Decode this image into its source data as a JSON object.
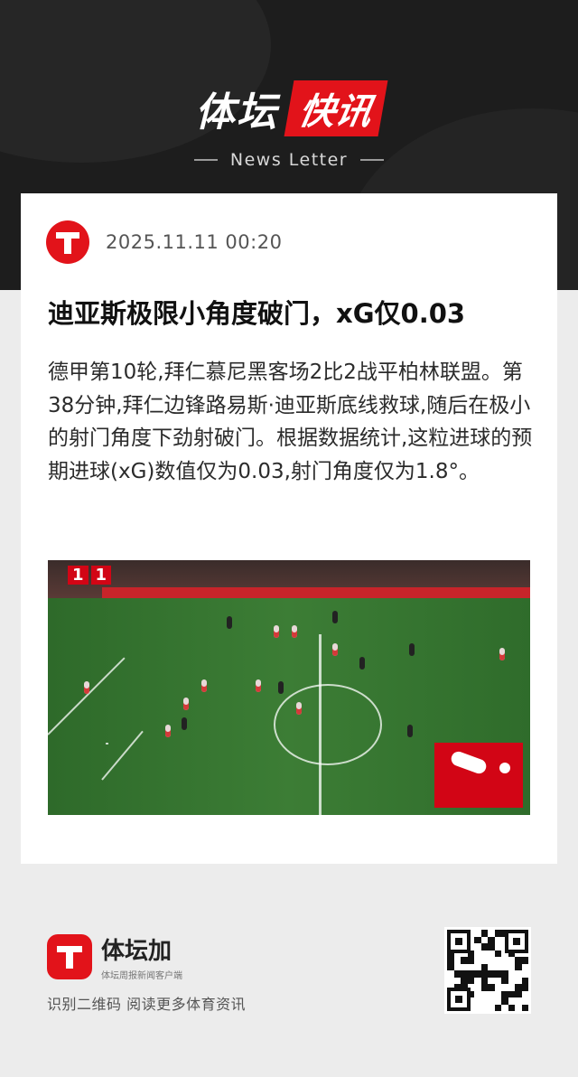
{
  "header": {
    "brand_main": "体坛",
    "brand_accent": "快讯",
    "brand_sub": "News Letter"
  },
  "article": {
    "timestamp": "2025.11.11 00:20",
    "title": "迪亚斯极限小角度破门，xG仅0.03",
    "body": "德甲第10轮,拜仁慕尼黑客场2比2战平柏林联盟。第38分钟,拜仁边锋路易斯·迪亚斯底线救球,随后在极小的射门角度下劲射破门。根据数据统计,这粒进球的预期进球(xG)数值仅为0.03,射门角度仅为1.8°。",
    "image": {
      "description_icon": "match-photo",
      "score_home": "1",
      "score_away": "1"
    }
  },
  "footer": {
    "app_name": "体坛加",
    "app_tag": "体坛周报新闻客户端",
    "scan_hint": "识别二维码 阅读更多体育资讯"
  },
  "colors": {
    "accent": "#e2131a",
    "header_bg": "#1d1d1d",
    "page_bg": "#ececec"
  }
}
